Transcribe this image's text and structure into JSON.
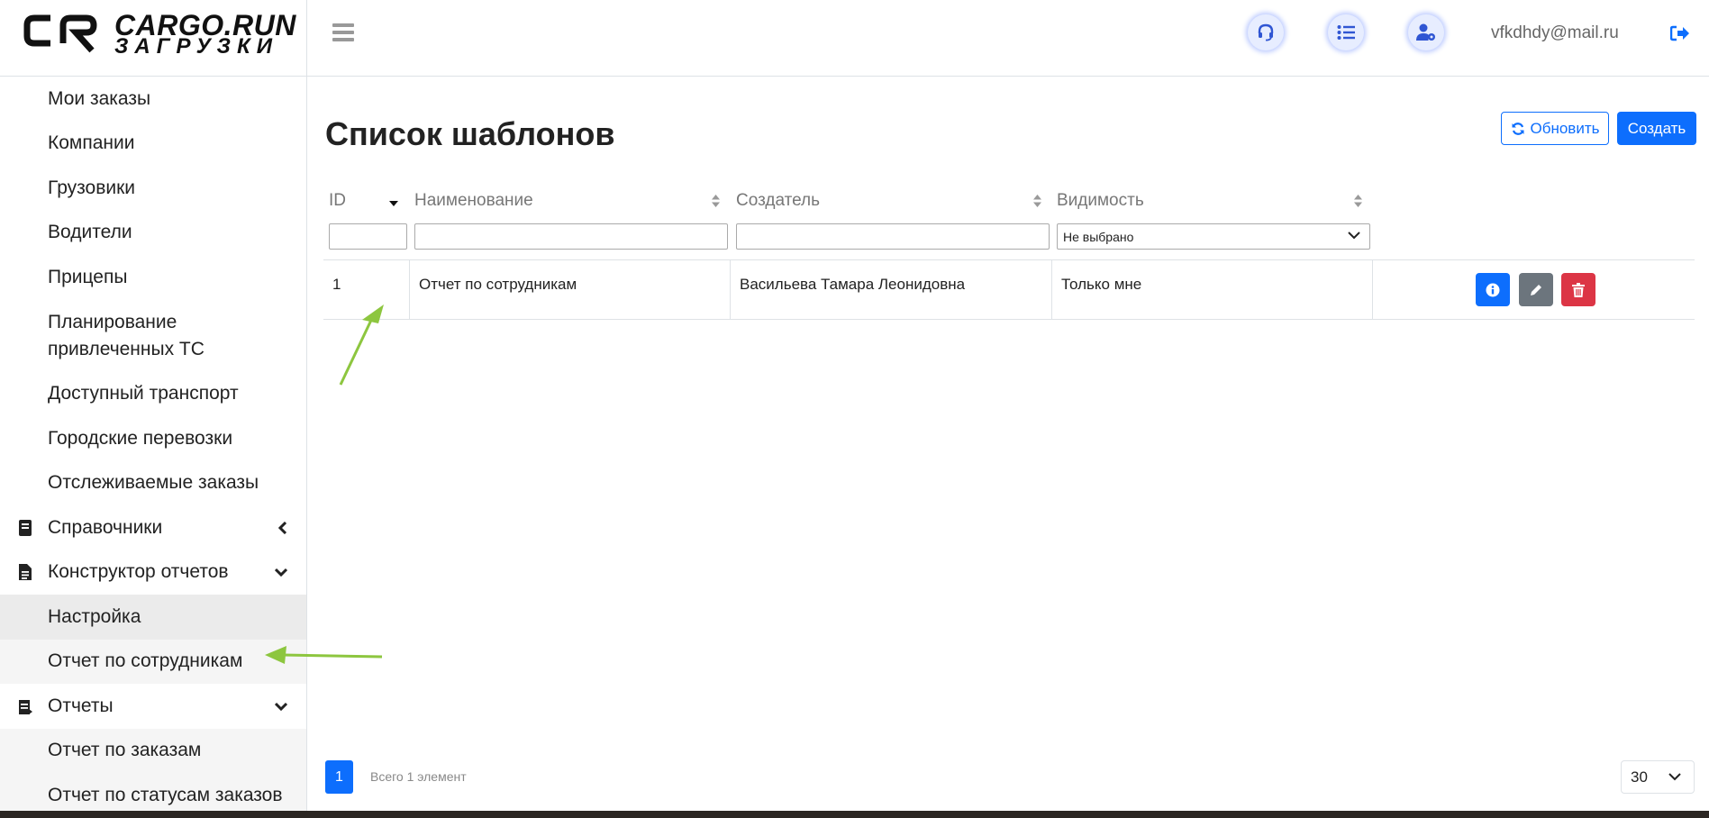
{
  "brand": {
    "name": "CARGO.RUN",
    "subtitle": "ЗАГРУЗКИ"
  },
  "sidebar": {
    "items": [
      {
        "label": "Мои заказы"
      },
      {
        "label": "Компании"
      },
      {
        "label": "Грузовики"
      },
      {
        "label": "Водители"
      },
      {
        "label": "Прицепы"
      },
      {
        "label": "Планирование привлеченных ТС"
      },
      {
        "label": "Доступный транспорт"
      },
      {
        "label": "Городские перевозки"
      },
      {
        "label": "Отслеживаемые заказы"
      }
    ],
    "groups": {
      "references": {
        "label": "Справочники",
        "icon": "book-icon"
      },
      "report_builder": {
        "label": "Конструктор отчетов",
        "icon": "document-icon"
      },
      "reports": {
        "label": "Отчеты",
        "icon": "report-icon"
      }
    },
    "report_builder_items": [
      {
        "label": "Настройка"
      },
      {
        "label": "Отчет по сотрудникам"
      }
    ],
    "reports_items": [
      {
        "label": "Отчет по заказам"
      },
      {
        "label": "Отчет по статусам заказов"
      }
    ]
  },
  "header": {
    "user_email": "vfkdhdy@mail.ru",
    "icons": [
      "headset-icon",
      "list-icon",
      "user-settings-icon",
      "logout-icon"
    ]
  },
  "page": {
    "title": "Список шаблонов",
    "refresh_label": "Обновить",
    "create_label": "Создать"
  },
  "table": {
    "columns": [
      "ID",
      "Наименование",
      "Создатель",
      "Видимость"
    ],
    "visibility_filter": "Не выбрано",
    "rows": [
      {
        "id": "1",
        "name": "Отчет по сотрудникам",
        "creator": "Васильева Тамара Леонидовна",
        "visibility": "Только мне"
      }
    ]
  },
  "pagination": {
    "page": "1",
    "total": "Всего 1 элемент",
    "per_page": "30"
  },
  "colors": {
    "primary": "#0d6efd",
    "secondary": "#6c757d",
    "danger": "#dc3545",
    "annotation_arrow": "#8dc63f"
  }
}
